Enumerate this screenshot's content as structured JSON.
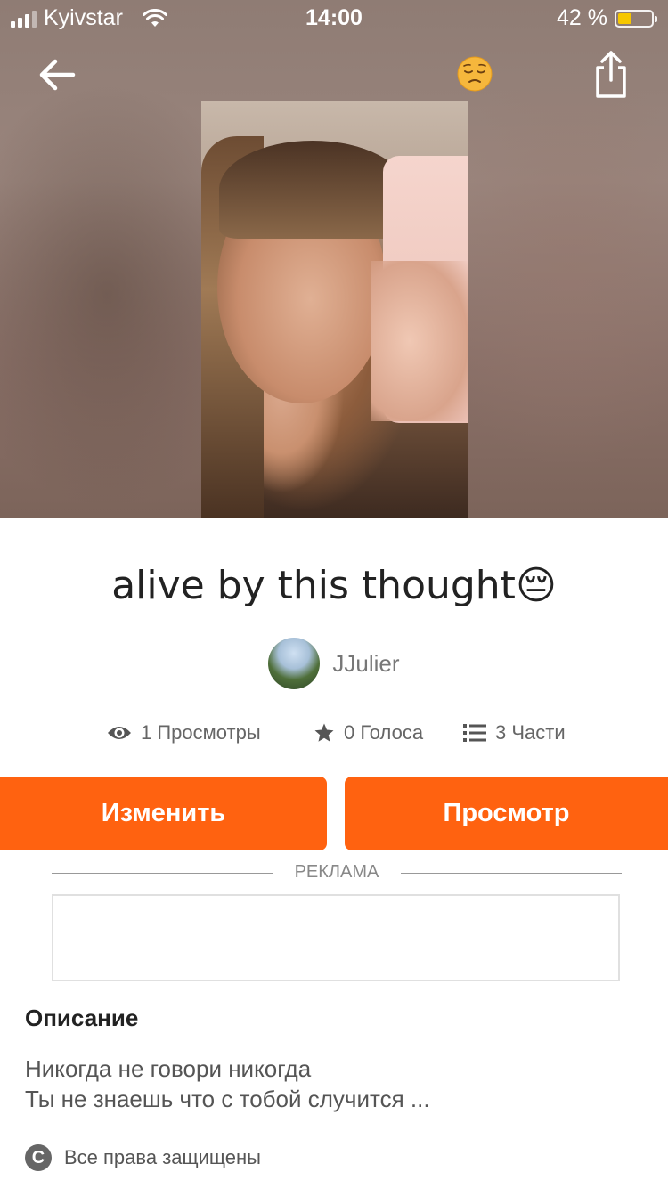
{
  "status_bar": {
    "carrier": "Kyivstar",
    "time": "14:00",
    "battery": "42 %",
    "battery_level": 0.42
  },
  "header": {
    "back_icon": "arrow-left-icon",
    "emoji": "pensive-face-emoji",
    "share_icon": "share-icon"
  },
  "story": {
    "title": "alive by this thought😔",
    "author": "JJulier",
    "stats": {
      "views": "1 Просмотры",
      "votes": "0 Голоса",
      "parts": "3 Части"
    }
  },
  "actions": {
    "edit_label": "Изменить",
    "read_label": "Просмотр"
  },
  "ad": {
    "label": "РЕКЛАМА"
  },
  "description": {
    "title": "Описание",
    "line1": "Никогда не говори никогда",
    "line2": "Ты не знаешь что с тобой случится ...",
    "rights": "Все права защищены"
  },
  "colors": {
    "accent": "#ff6210",
    "battery": "#f6c700"
  }
}
